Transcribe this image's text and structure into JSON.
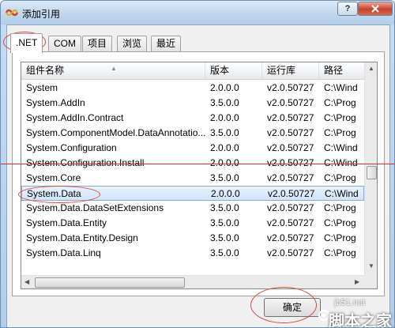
{
  "window": {
    "title": "添加引用",
    "help_label": "?",
    "close_label": "×"
  },
  "tabs": [
    {
      "label": ".NET",
      "active": true
    },
    {
      "label": "COM",
      "active": false
    },
    {
      "label": "项目",
      "active": false
    },
    {
      "label": "浏览",
      "active": false
    },
    {
      "label": "最近",
      "active": false
    }
  ],
  "columns": [
    "组件名称",
    "版本",
    "运行库",
    "路径"
  ],
  "rows": [
    {
      "name": "System",
      "version": "2.0.0.0",
      "runtime": "v2.0.50727",
      "path": "C:\\Wind"
    },
    {
      "name": "System.AddIn",
      "version": "3.5.0.0",
      "runtime": "v2.0.50727",
      "path": "C:\\Prog"
    },
    {
      "name": "System.AddIn.Contract",
      "version": "2.0.0.0",
      "runtime": "v2.0.50727",
      "path": "C:\\Prog"
    },
    {
      "name": "System.ComponentModel.DataAnnotatio...",
      "version": "3.5.0.0",
      "runtime": "v2.0.50727",
      "path": "C:\\Prog"
    },
    {
      "name": "System.Configuration",
      "version": "2.0.0.0",
      "runtime": "v2.0.50727",
      "path": "C:\\Wind"
    },
    {
      "name": "System.Configuration.Install",
      "version": "2.0.0.0",
      "runtime": "v2.0.50727",
      "path": "C:\\Wind"
    },
    {
      "name": "System.Core",
      "version": "3.5.0.0",
      "runtime": "v2.0.50727",
      "path": "C:\\Prog"
    },
    {
      "name": "System.Data",
      "version": "2.0.0.0",
      "runtime": "v2.0.50727",
      "path": "C:\\Wind",
      "selected": true
    },
    {
      "name": "System.Data.DataSetExtensions",
      "version": "3.5.0.0",
      "runtime": "v2.0.50727",
      "path": "C:\\Prog"
    },
    {
      "name": "System.Data.Entity",
      "version": "3.5.0.0",
      "runtime": "v2.0.50727",
      "path": "C:\\Prog"
    },
    {
      "name": "System.Data.Entity.Design",
      "version": "3.5.0.0",
      "runtime": "v2.0.50727",
      "path": "C:\\Prog"
    },
    {
      "name": "System.Data.Linq",
      "version": "3.5.0.0",
      "runtime": "v2.0.50727",
      "path": "C:\\Prog"
    }
  ],
  "buttons": {
    "ok_label": "确定"
  },
  "watermark": {
    "site": "jb51.net",
    "brand": "脚本之家"
  },
  "colors": {
    "annotation": "#d94a3e",
    "selection": "#cfe5fa"
  }
}
